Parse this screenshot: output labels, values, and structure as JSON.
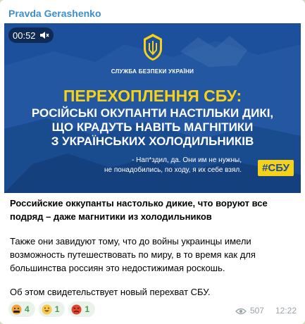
{
  "channel": {
    "name": "Pravda Gerashenko"
  },
  "video": {
    "duration": "00:52",
    "org_name": "СЛУЖБА БЕЗПЕКИ УКРАЇНИ",
    "headline": "ПЕРЕХОПЛЕННЯ СБУ:",
    "subtitle_lines": [
      "РОСІЙСЬКІ ОКУПАНТИ НАСТІЛЬКИ ДИКІ,",
      "ЩО КРАДУТЬ НАВІТЬ МАГНІТИКИ",
      "З УКРАЇНСЬКИХ ХОЛОДИЛЬНИКІВ"
    ],
    "quote_lines": [
      "- Нап*здил, да. Они им не нужны,",
      "не понадобились, по ходу, я их себе взял."
    ],
    "hashtag": "#СБУ"
  },
  "message": {
    "title_lines": [
      "Российские оккупанты настолько дикие, что воруют все",
      "подряд – даже магнитики из холодильников"
    ],
    "paragraph1_lines": [
      "Также они завидуют тому, что до войны украинцы имели",
      "возможность путешествовать по миру, в то время как для",
      "большинства россиян это недостижимая роскошь."
    ],
    "paragraph2": "Об этом свидетельствует новый перехват СБУ."
  },
  "reactions": [
    {
      "icon": "angry-curse-emoji-icon",
      "count": "4"
    },
    {
      "icon": "grinning-emoji-icon",
      "count": "1"
    },
    {
      "icon": "enraged-face-emoji-icon",
      "count": "1"
    }
  ],
  "meta": {
    "views": "507",
    "time": "12:22"
  },
  "colors": {
    "channel_name": "#3d8fcd",
    "banner_blue": "#1c4f9c",
    "headline_yellow": "#f7d118",
    "reaction_bg": "#e9f3ea",
    "reaction_text": "#4d9a52",
    "meta_gray": "#9aa5a9"
  }
}
